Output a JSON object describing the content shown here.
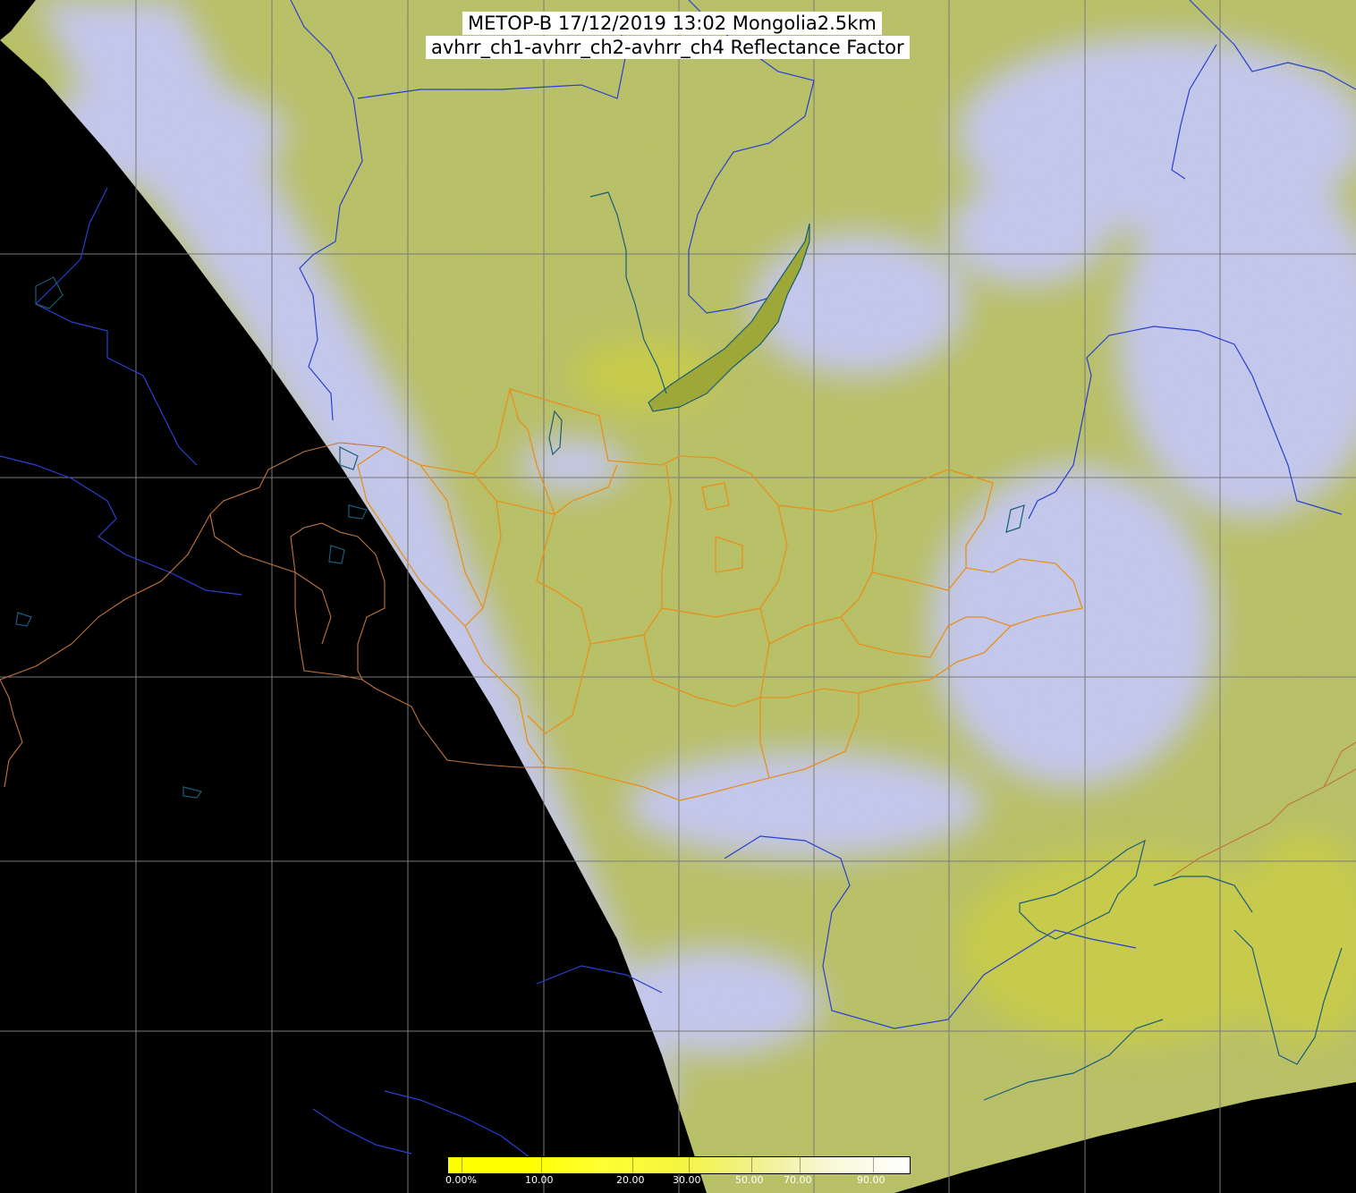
{
  "header": {
    "title_line1": "METOP-B 17/12/2019 13:02 Mongolia2.5km",
    "title_line2": "avhrr_ch1-avhrr_ch2-avhrr_ch4 Reflectance Factor"
  },
  "colorbar": {
    "ticks": [
      "0.00%",
      "10.00",
      "20.00",
      "30.00",
      "50.00",
      "70.00",
      "90.00"
    ],
    "colors": [
      "#ffff00",
      "#ffff00",
      "#ffff33",
      "#f5f540",
      "#f0f090",
      "#f8f8d8",
      "#ffffff"
    ]
  },
  "colors": {
    "no_data": "#000000",
    "surface": "#b8c060",
    "cloud": "#c4c8f0",
    "grid": "#808080",
    "rivers": "#2040d0",
    "coast": "#205878",
    "borders_mongolia": "#e89020",
    "borders_other": "#c07040"
  }
}
